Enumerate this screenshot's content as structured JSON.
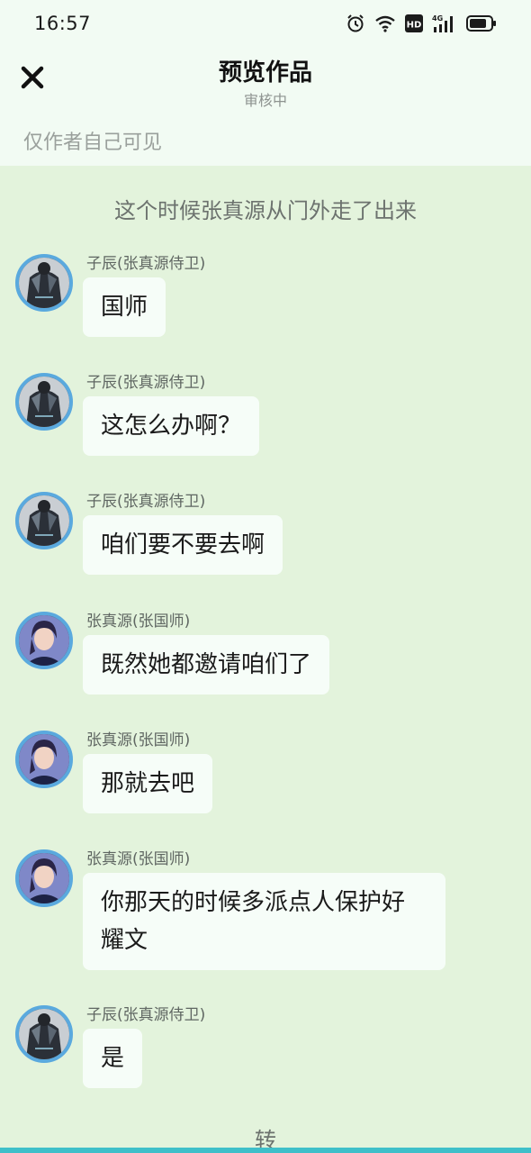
{
  "status": {
    "time": "16:57",
    "network": "4G",
    "hd": "HD"
  },
  "header": {
    "title": "预览作品",
    "subtitle": "审核中"
  },
  "visibility_note": "仅作者自己可见",
  "narration": "这个时候张真源从门外走了出来",
  "messages": [
    {
      "sender": "子辰(张真源侍卫)",
      "text": "国师",
      "avatar": "guard-avatar"
    },
    {
      "sender": "子辰(张真源侍卫)",
      "text": "这怎么办啊？",
      "avatar": "guard-avatar"
    },
    {
      "sender": "子辰(张真源侍卫)",
      "text": "咱们要不要去啊",
      "avatar": "guard-avatar"
    },
    {
      "sender": "张真源(张国师)",
      "text": "既然她都邀请咱们了",
      "avatar": "master-avatar"
    },
    {
      "sender": "张真源(张国师)",
      "text": "那就去吧",
      "avatar": "master-avatar"
    },
    {
      "sender": "张真源(张国师)",
      "text": "你那天的时候多派点人保护好耀文",
      "avatar": "master-avatar"
    },
    {
      "sender": "子辰(张真源侍卫)",
      "text": "是",
      "avatar": "guard-avatar"
    }
  ],
  "footer_text": "转",
  "colors": {
    "background": "#e3f3dc",
    "header_bg": "#f2fbf3",
    "avatar_ring": "#5aa9de",
    "bubble": "#f6fdf8"
  }
}
